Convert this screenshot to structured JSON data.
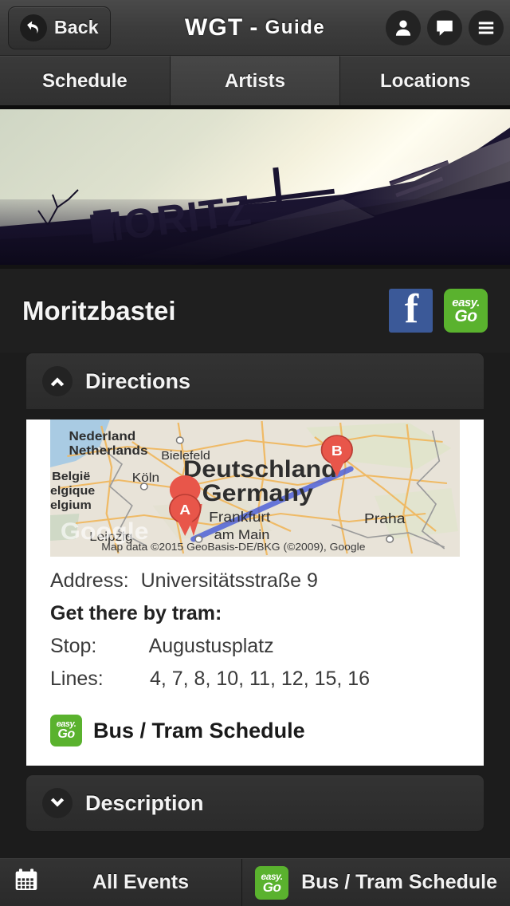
{
  "header": {
    "back_label": "Back",
    "title_main": "WGT",
    "title_sep": "-",
    "title_rest": "Guide",
    "icons": [
      "user-icon",
      "chat-icon",
      "menu-icon"
    ]
  },
  "tabs": [
    {
      "label": "Schedule",
      "active": false
    },
    {
      "label": "Artists",
      "active": true
    },
    {
      "label": "Locations",
      "active": false
    }
  ],
  "hero": {
    "sign_text": "MORITZ"
  },
  "venue": {
    "name": "Moritzbastei",
    "facebook_label": "f",
    "easygo_top": "easy.",
    "easygo_bottom": "Go"
  },
  "panels": {
    "directions": {
      "title": "Directions",
      "expanded": true,
      "chevron": "chevron-up-icon"
    },
    "description": {
      "title": "Description",
      "expanded": false,
      "chevron": "chevron-down-icon"
    }
  },
  "map": {
    "labels": [
      "Nederland",
      "Netherlands",
      "Bielefeld",
      "België",
      "Belgique",
      "Belgium",
      "Köln",
      "Deutschland",
      "Germany",
      "Frankfurt",
      "am Main",
      "Praha",
      "Leipzig"
    ],
    "marker_a": "A",
    "marker_b": "B",
    "watermark": "Google",
    "attribution": "Map data ©2015 GeoBasis-DE/BKG (©2009), Google"
  },
  "directions": {
    "address_label": "Address:",
    "address_value": "Universitätsstraße 9",
    "tram_heading": "Get there by tram:",
    "stop_label": "Stop:",
    "stop_value": "Augustusplatz",
    "lines_label": "Lines:",
    "lines_value": "4, 7, 8, 10, 11, 12, 15, 16",
    "schedule_link": "Bus / Tram Schedule"
  },
  "bottom_bar": {
    "all_events": "All Events",
    "bus_tram": "Bus / Tram Schedule",
    "calendar_icon": "calendar-icon"
  },
  "colors": {
    "facebook": "#3b5998",
    "easygo_green": "#5ab22e",
    "page_bg": "#1c1c1c",
    "panel_bg": "#2e2e2e"
  }
}
